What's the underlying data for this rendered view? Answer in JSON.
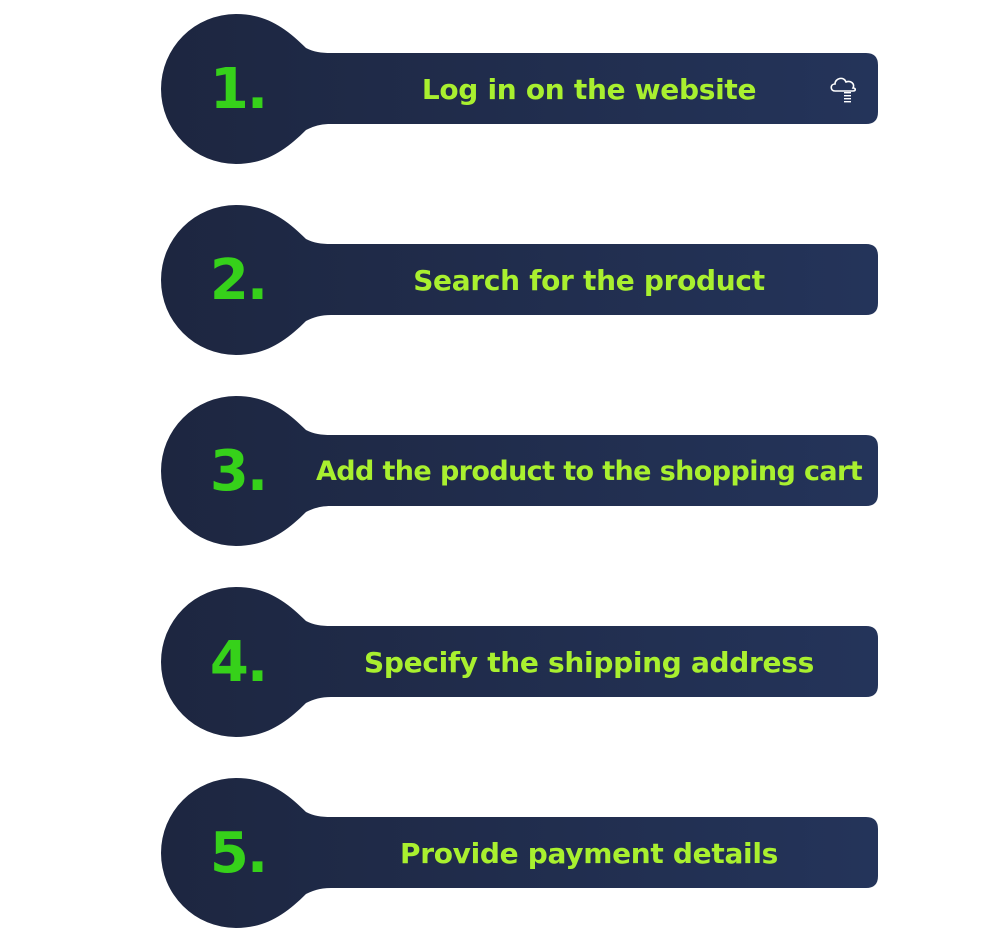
{
  "colors": {
    "background": "#ffffff",
    "shape": "#1f2945",
    "number": "#36d11a",
    "label": "#a9f02f",
    "icon": "#ffffff"
  },
  "steps": [
    {
      "number": "1.",
      "label": "Log in on the website"
    },
    {
      "number": "2.",
      "label": "Search for the product"
    },
    {
      "number": "3.",
      "label": "Add the product to the shopping cart"
    },
    {
      "number": "4.",
      "label": "Specify the shipping address"
    },
    {
      "number": "5.",
      "label": "Provide payment details"
    }
  ],
  "icons": {
    "step1": "cloud-icon"
  }
}
